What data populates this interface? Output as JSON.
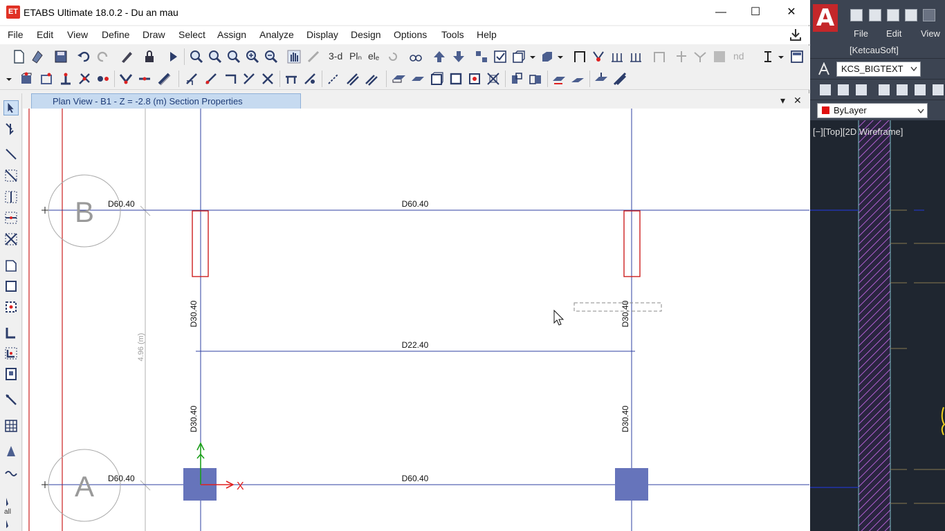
{
  "etabs": {
    "app_logo": "ET",
    "title": "ETABS Ultimate 18.0.2 - Du an mau",
    "window_controls": {
      "minimize": "—",
      "maximize": "☐",
      "close": "✕"
    },
    "menu": [
      "File",
      "Edit",
      "View",
      "Define",
      "Draw",
      "Select",
      "Assign",
      "Analyze",
      "Display",
      "Design",
      "Options",
      "Tools",
      "Help"
    ],
    "toolbar": {
      "view_3d_label": "3-d",
      "plan_label": "Plₙ",
      "elev_label": "elₑ",
      "nd_label": "nd"
    },
    "tab": {
      "label": "Plan View - B1 - Z = -2.8 (m)  Section Properties",
      "dropdown": "▾",
      "close": "✕"
    },
    "left_toolbar": {
      "all_label": "all"
    },
    "plan": {
      "grid_bubbles": [
        "B",
        "A"
      ],
      "beam_labels": {
        "b_left": "D60.40",
        "b_main": "D60.40",
        "mid_beam": "D22.40",
        "a_left": "D60.40",
        "a_main": "D60.40",
        "col_left_upper": "D30.40",
        "col_right_upper": "D30.40",
        "col_left_lower": "D30.40",
        "col_right_lower": "D30.40"
      },
      "dimension_label": "4.96 (m)",
      "axis_x_label": "X",
      "colors": {
        "grid_line": "#2e3fa0",
        "red_line": "#cc2020",
        "column_fill": "#6674bb",
        "axis_green": "#1a9e1a",
        "axis_red": "#e02020"
      }
    }
  },
  "autocad": {
    "logo": "A",
    "menu": [
      "File",
      "Edit",
      "View"
    ],
    "brand": "[KetcauSoft]",
    "text_style": "KCS_BIGTEXT",
    "layer": "ByLayer",
    "viewport_label": "[−][Top][2D Wireframe]"
  }
}
